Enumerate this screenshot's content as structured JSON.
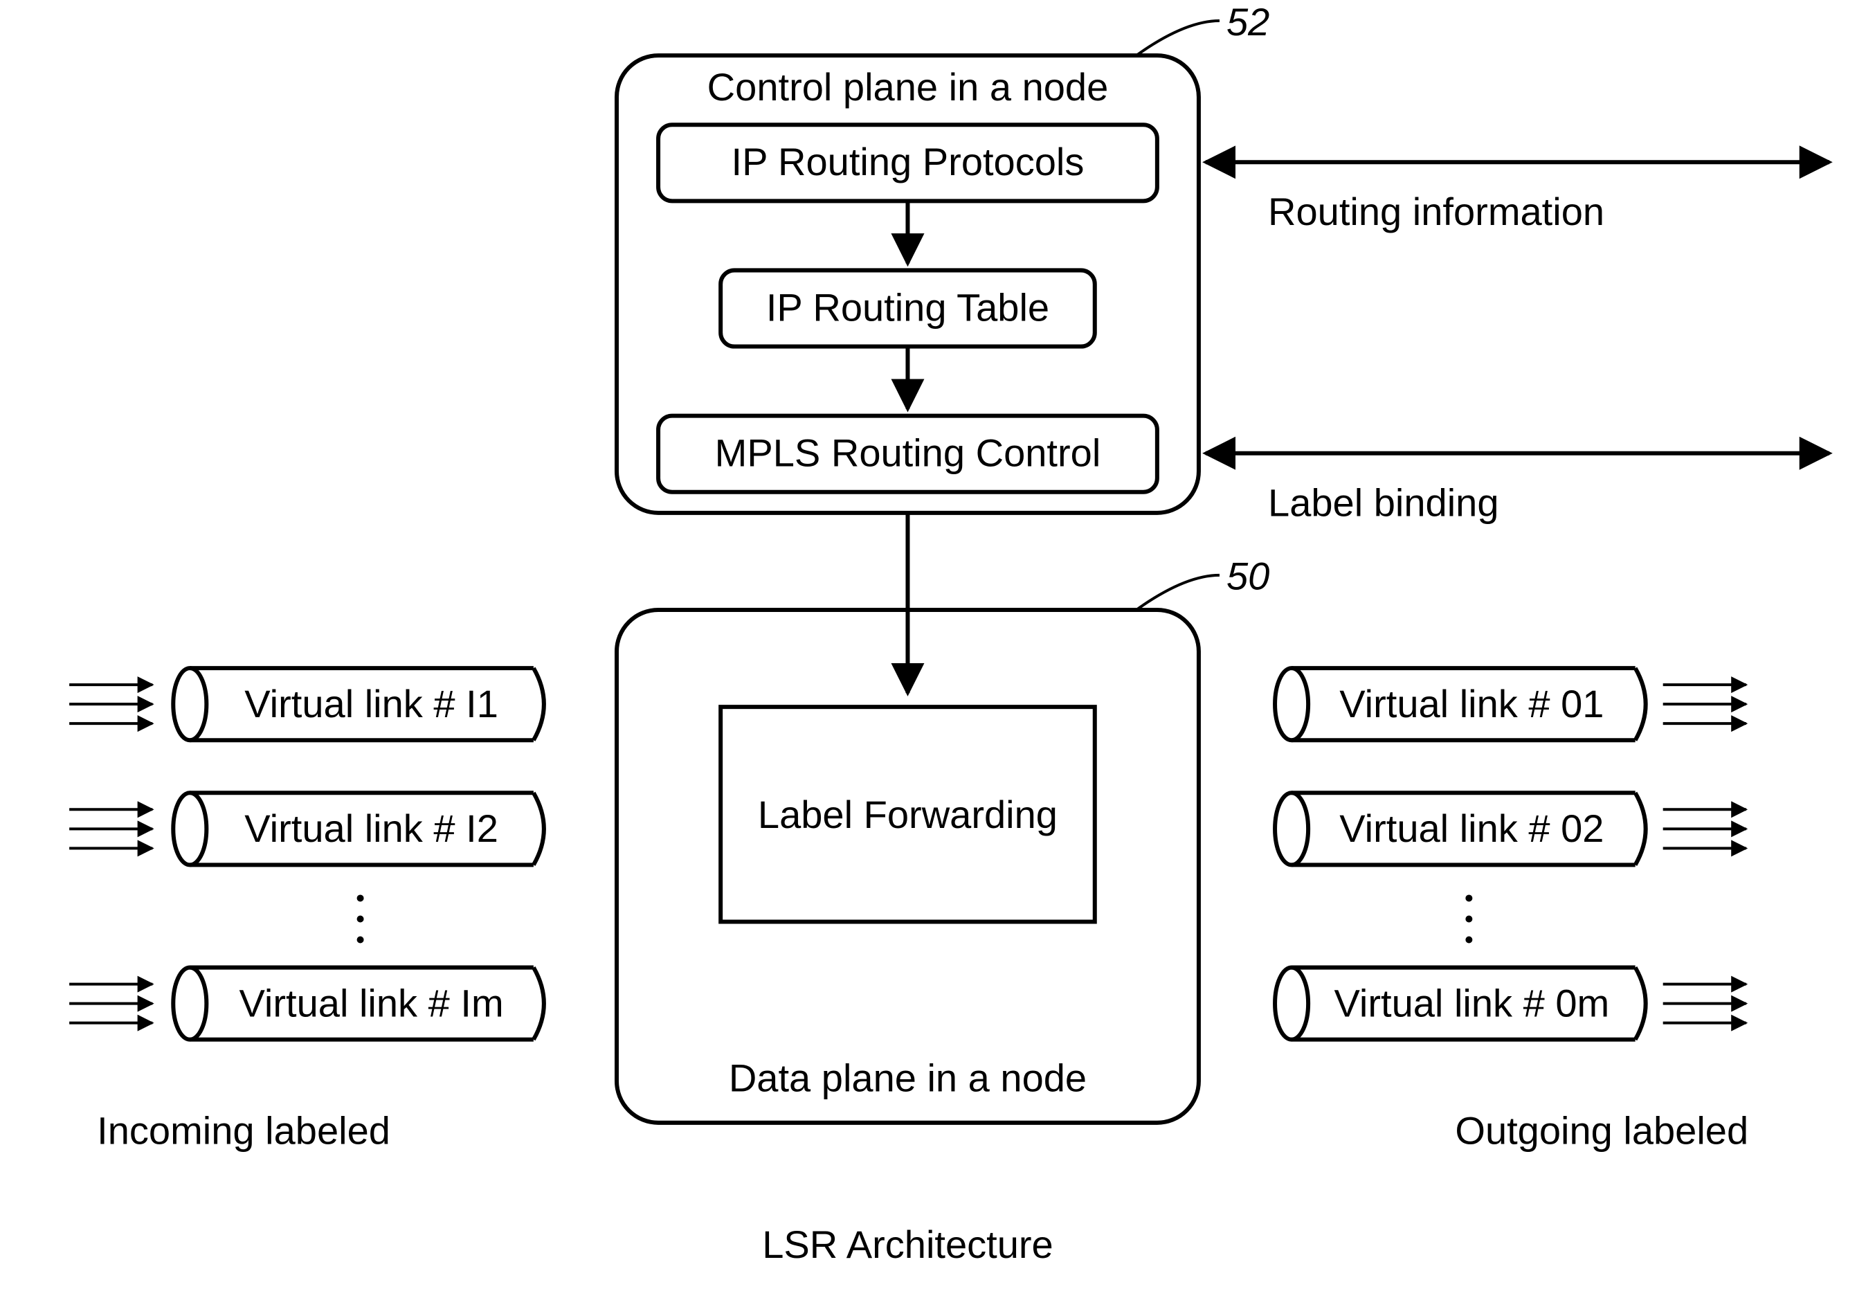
{
  "title": "LSR Architecture",
  "controlPlane": {
    "label": "Control plane in a node",
    "ref": "52",
    "boxes": {
      "ipRoutingProtocols": "IP Routing Protocols",
      "ipRoutingTable": "IP Routing Table",
      "mplsRoutingControl": "MPLS Routing Control"
    },
    "rightLabels": {
      "routingInfo": "Routing information",
      "labelBinding": "Label binding"
    }
  },
  "dataPlane": {
    "label": "Data plane in a node",
    "ref": "50",
    "boxes": {
      "labelForwarding": "Label Forwarding"
    }
  },
  "incoming": {
    "caption": "Incoming labeled",
    "links": [
      "Virtual link # I1",
      "Virtual link # I2",
      "Virtual link # Im"
    ]
  },
  "outgoing": {
    "caption": "Outgoing labeled",
    "links": [
      "Virtual link # 01",
      "Virtual link # 02",
      "Virtual link # 0m"
    ]
  }
}
